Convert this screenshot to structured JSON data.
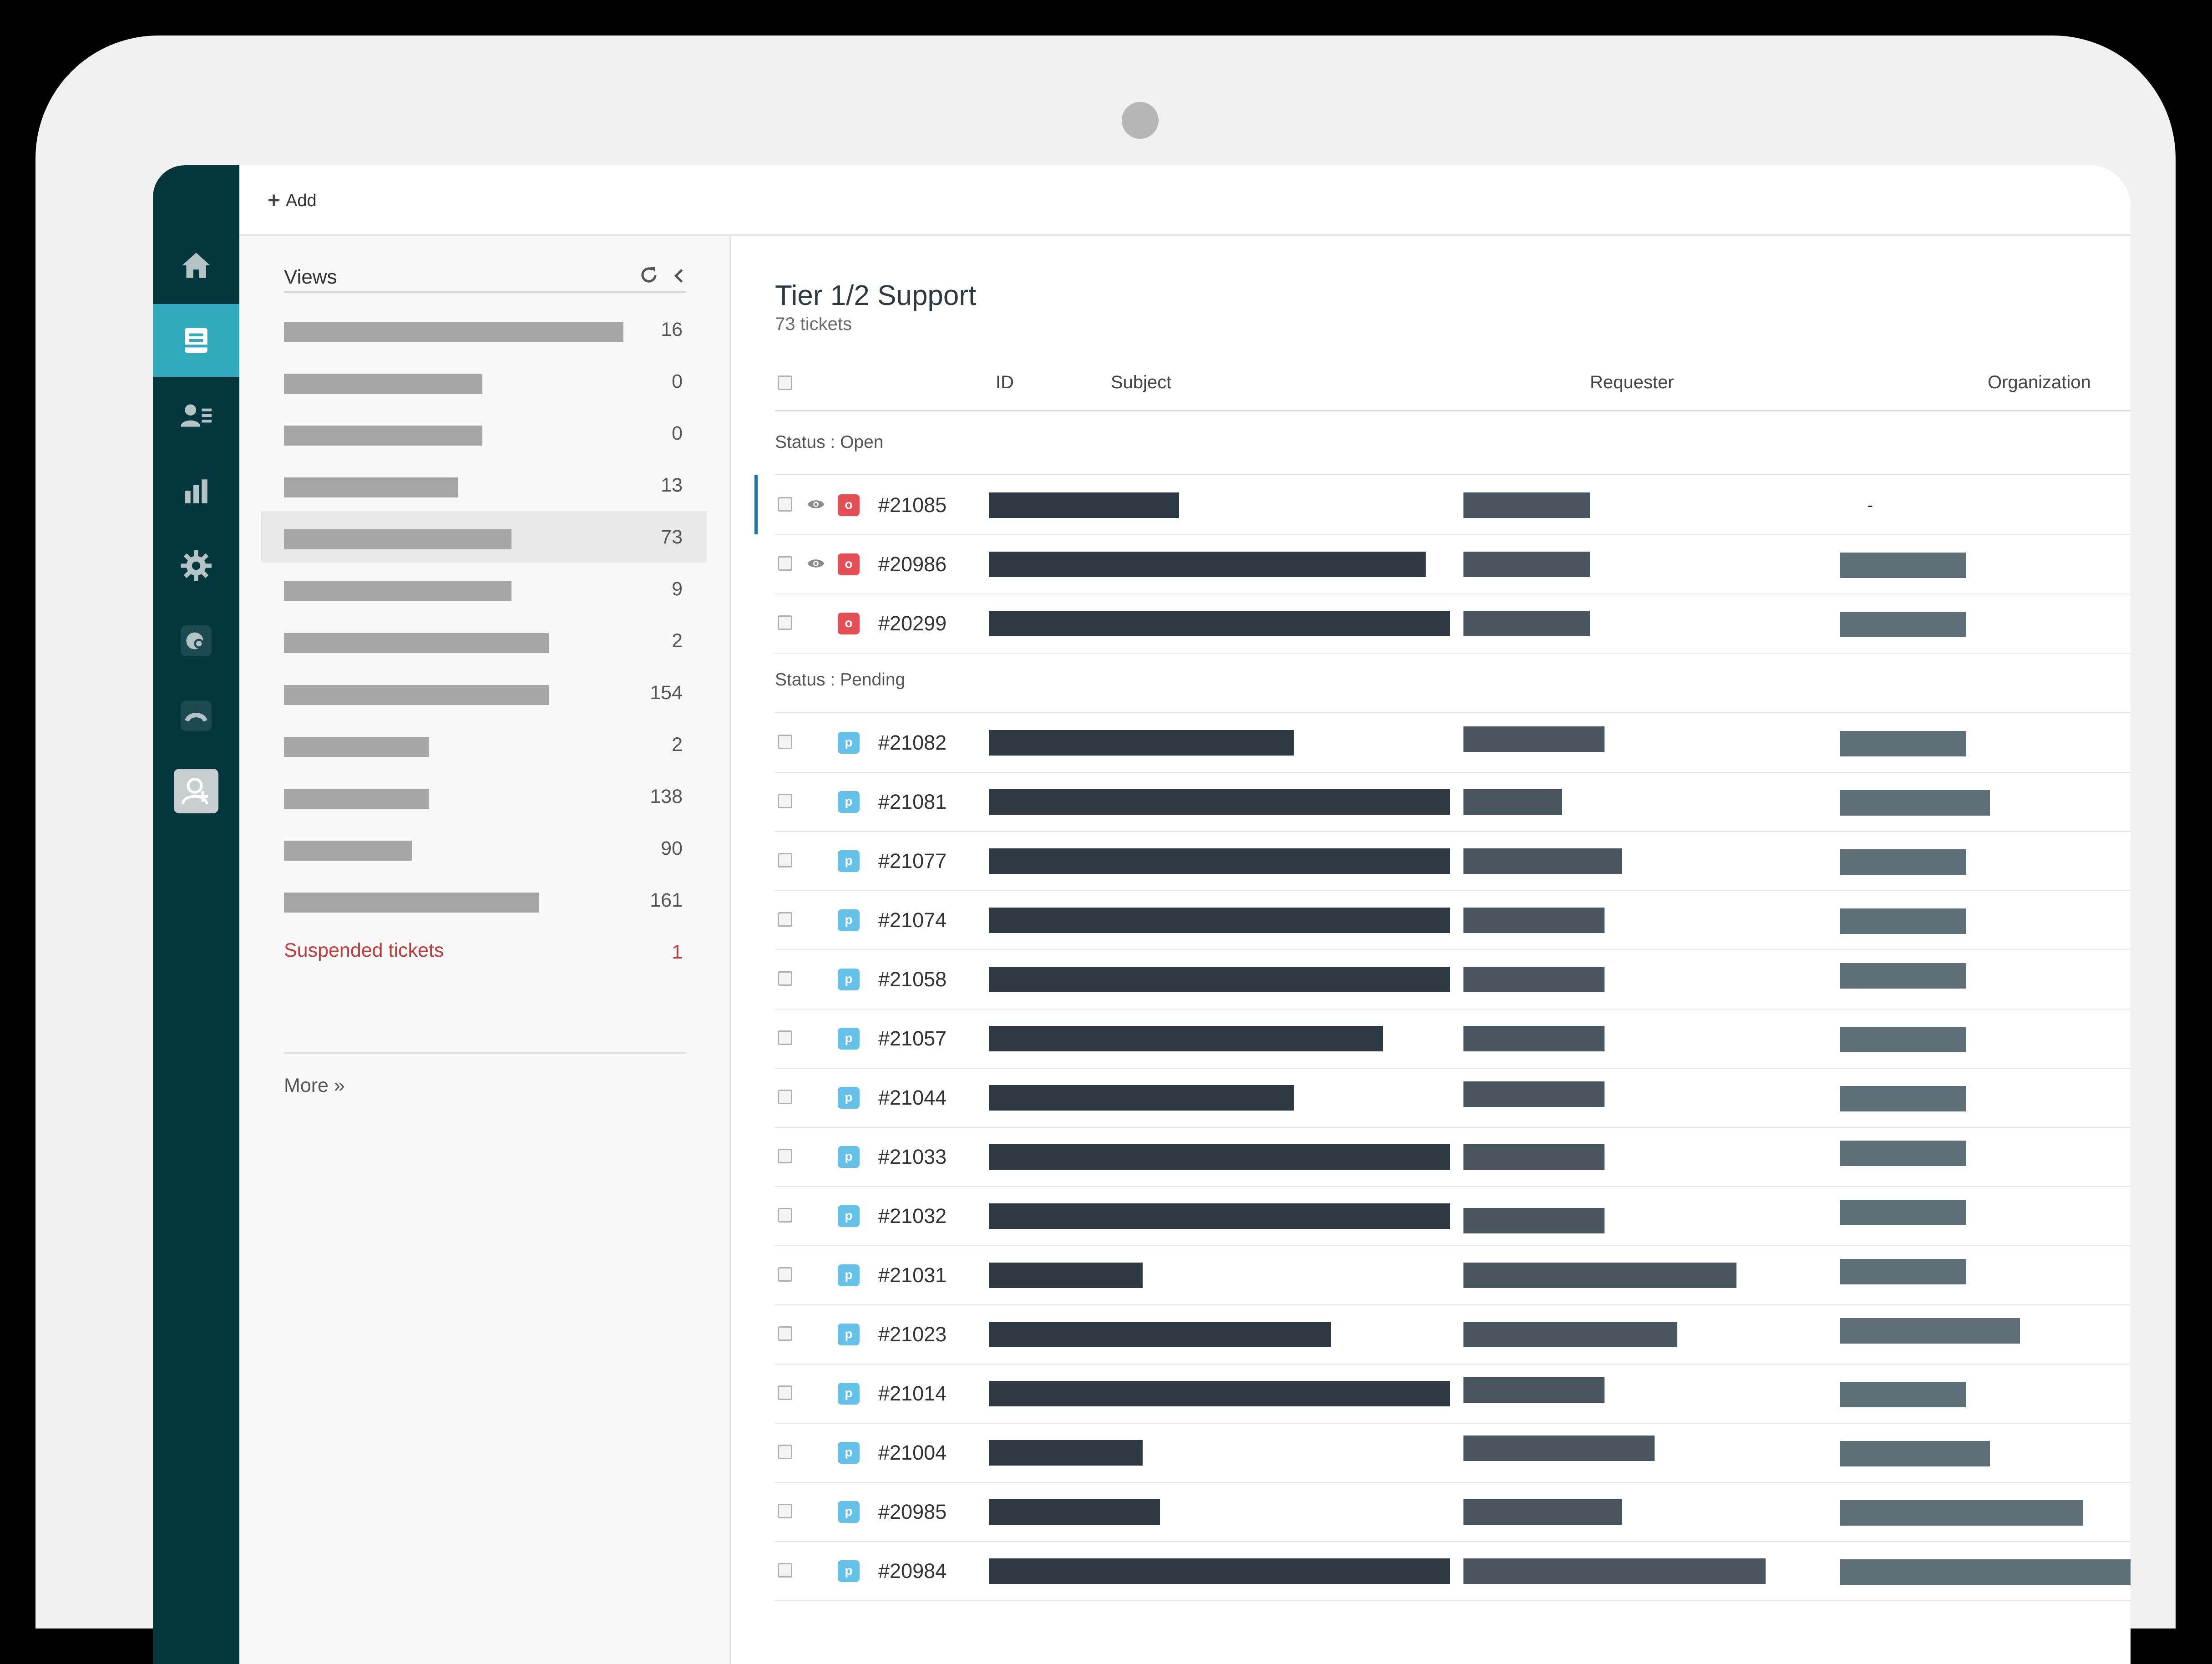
{
  "topbar": {
    "add_label": "Add"
  },
  "views": {
    "title": "Views",
    "items": [
      {
        "count": "16"
      },
      {
        "count": "0"
      },
      {
        "count": "0"
      },
      {
        "count": "13"
      },
      {
        "count": "73",
        "selected": true
      },
      {
        "count": "9"
      },
      {
        "count": "2"
      },
      {
        "count": "154"
      },
      {
        "count": "2"
      },
      {
        "count": "138"
      },
      {
        "count": "90"
      },
      {
        "count": "161"
      }
    ],
    "suspended": {
      "label": "Suspended tickets",
      "count": "1"
    },
    "more_label": "More »"
  },
  "main": {
    "title": "Tier 1/2 Support",
    "subtitle": "73 tickets",
    "columns": {
      "id": "ID",
      "subject": "Subject",
      "requester": "Requester",
      "organization": "Organization"
    },
    "groups": [
      {
        "label": "Status : Open",
        "tickets": [
          {
            "id": "#21085",
            "status": "o",
            "viewing": true,
            "org": "-"
          },
          {
            "id": "#20986",
            "status": "o",
            "viewing": true
          },
          {
            "id": "#20299",
            "status": "o",
            "viewing": false
          }
        ]
      },
      {
        "label": "Status : Pending",
        "tickets": [
          {
            "id": "#21082",
            "status": "p"
          },
          {
            "id": "#21081",
            "status": "p"
          },
          {
            "id": "#21077",
            "status": "p"
          },
          {
            "id": "#21074",
            "status": "p"
          },
          {
            "id": "#21058",
            "status": "p"
          },
          {
            "id": "#21057",
            "status": "p"
          },
          {
            "id": "#21044",
            "status": "p"
          },
          {
            "id": "#21033",
            "status": "p"
          },
          {
            "id": "#21032",
            "status": "p"
          },
          {
            "id": "#21031",
            "status": "p"
          },
          {
            "id": "#21023",
            "status": "p"
          },
          {
            "id": "#21014",
            "status": "p"
          },
          {
            "id": "#21004",
            "status": "p"
          },
          {
            "id": "#20985",
            "status": "p"
          },
          {
            "id": "#20984",
            "status": "p"
          }
        ]
      }
    ]
  },
  "colors": {
    "nav_bg": "#03363d",
    "nav_active": "#30aabc",
    "open_badge": "#e34f55",
    "pending_badge": "#66c1e8",
    "suspended_text": "#c23b3b",
    "redaction_dark": "#2f3941"
  },
  "icons": [
    "home-icon",
    "tickets-icon",
    "customers-icon",
    "reporting-icon",
    "admin-gear-icon",
    "talk-icon",
    "phone-icon",
    "add-user-icon",
    "refresh-icon",
    "collapse-chevron-icon",
    "eye-icon"
  ]
}
